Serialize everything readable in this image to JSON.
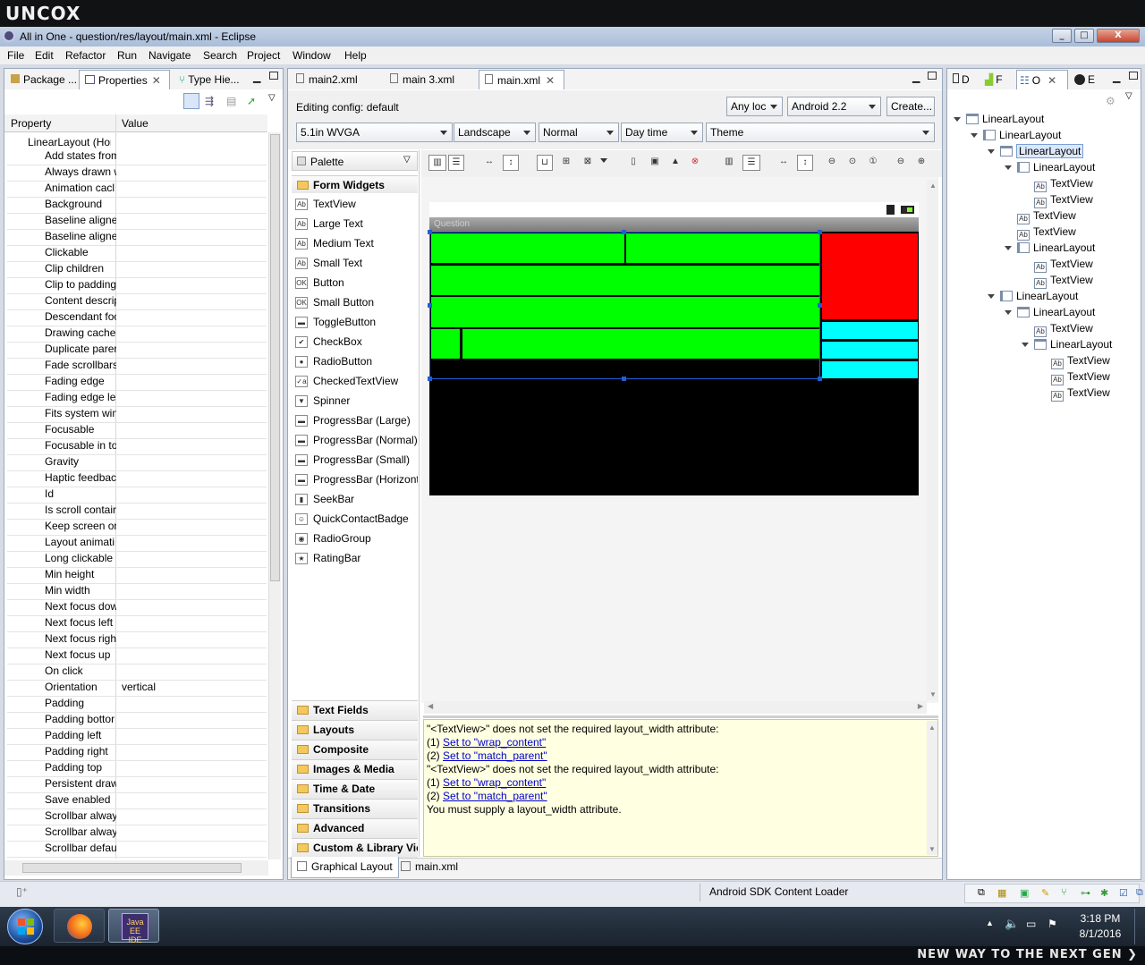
{
  "brand": "UNCOX",
  "window": {
    "title": "All in One - question/res/layout/main.xml - Eclipse",
    "min": "_",
    "max": "□",
    "close": "X"
  },
  "menu": [
    "File",
    "Edit",
    "Refactor",
    "Run",
    "Navigate",
    "Search",
    "Project",
    "Window",
    "Help"
  ],
  "left_tabs": [
    "Package ...",
    "Properties",
    "Type Hie..."
  ],
  "properties": {
    "col_property": "Property",
    "col_value": "Value",
    "root": "LinearLayout (Hori",
    "rows": [
      {
        "name": "Add states from",
        "value": ""
      },
      {
        "name": "Always drawn w",
        "value": ""
      },
      {
        "name": "Animation cacl",
        "value": ""
      },
      {
        "name": "Background",
        "value": ""
      },
      {
        "name": "Baseline aligne",
        "value": ""
      },
      {
        "name": "Baseline aligne",
        "value": ""
      },
      {
        "name": "Clickable",
        "value": ""
      },
      {
        "name": "Clip children",
        "value": ""
      },
      {
        "name": "Clip to padding",
        "value": ""
      },
      {
        "name": "Content descrip",
        "value": ""
      },
      {
        "name": "Descendant foc",
        "value": ""
      },
      {
        "name": "Drawing cache",
        "value": ""
      },
      {
        "name": "Duplicate parer",
        "value": ""
      },
      {
        "name": "Fade scrollbars",
        "value": ""
      },
      {
        "name": "Fading edge",
        "value": ""
      },
      {
        "name": "Fading edge ler",
        "value": ""
      },
      {
        "name": "Fits system win",
        "value": ""
      },
      {
        "name": "Focusable",
        "value": ""
      },
      {
        "name": "Focusable in to",
        "value": ""
      },
      {
        "name": "Gravity",
        "value": ""
      },
      {
        "name": "Haptic feedbac",
        "value": ""
      },
      {
        "name": "Id",
        "value": ""
      },
      {
        "name": "Is scroll contair",
        "value": ""
      },
      {
        "name": "Keep screen on",
        "value": ""
      },
      {
        "name": "Layout animati",
        "value": ""
      },
      {
        "name": "Long clickable",
        "value": ""
      },
      {
        "name": "Min height",
        "value": ""
      },
      {
        "name": "Min width",
        "value": ""
      },
      {
        "name": "Next focus dow",
        "value": ""
      },
      {
        "name": "Next focus left",
        "value": ""
      },
      {
        "name": "Next focus righ",
        "value": ""
      },
      {
        "name": "Next focus up",
        "value": ""
      },
      {
        "name": "On click",
        "value": ""
      },
      {
        "name": "Orientation",
        "value": "vertical"
      },
      {
        "name": "Padding",
        "value": ""
      },
      {
        "name": "Padding bottor",
        "value": ""
      },
      {
        "name": "Padding left",
        "value": ""
      },
      {
        "name": "Padding right",
        "value": ""
      },
      {
        "name": "Padding top",
        "value": ""
      },
      {
        "name": "Persistent draw",
        "value": ""
      },
      {
        "name": "Save enabled",
        "value": ""
      },
      {
        "name": "Scrollbar alway",
        "value": ""
      },
      {
        "name": "Scrollbar alway",
        "value": ""
      },
      {
        "name": "Scrollbar defau",
        "value": ""
      }
    ]
  },
  "editor_tabs": [
    "main2.xml",
    "main 3.xml",
    "main.xml"
  ],
  "config": {
    "label": "Editing config:",
    "value": "default",
    "locale": "Any loc",
    "target": "Android 2.2",
    "create": "Create...",
    "device": "5.1in WVGA",
    "orientation": "Landscape",
    "dock": "Normal",
    "night": "Day time",
    "theme": "Theme"
  },
  "palette": {
    "title": "Palette",
    "open_section": "Form Widgets",
    "items": [
      {
        "label": "TextView",
        "icon": "Ab"
      },
      {
        "label": "Large Text",
        "icon": "Ab"
      },
      {
        "label": "Medium Text",
        "icon": "Ab"
      },
      {
        "label": "Small Text",
        "icon": "Ab"
      },
      {
        "label": "Button",
        "icon": "OK"
      },
      {
        "label": "Small Button",
        "icon": "OK"
      },
      {
        "label": "ToggleButton",
        "icon": "▬"
      },
      {
        "label": "CheckBox",
        "icon": "✔"
      },
      {
        "label": "RadioButton",
        "icon": "●"
      },
      {
        "label": "CheckedTextView",
        "icon": "✓a"
      },
      {
        "label": "Spinner",
        "icon": "▼"
      },
      {
        "label": "ProgressBar (Large)",
        "icon": "▬"
      },
      {
        "label": "ProgressBar (Normal)",
        "icon": "▬"
      },
      {
        "label": "ProgressBar (Small)",
        "icon": "▬"
      },
      {
        "label": "ProgressBar (Horizonta",
        "icon": "▬"
      },
      {
        "label": "SeekBar",
        "icon": "▮"
      },
      {
        "label": "QuickContactBadge",
        "icon": "☺"
      },
      {
        "label": "RadioGroup",
        "icon": "◉"
      },
      {
        "label": "RatingBar",
        "icon": "★"
      }
    ],
    "sections": [
      "Text Fields",
      "Layouts",
      "Composite",
      "Images & Media",
      "Time & Date",
      "Transitions",
      "Advanced",
      "Custom & Library Vie"
    ]
  },
  "device_screen": {
    "app_title": "Question"
  },
  "errors": {
    "msg1": "\"<TextView>\" does not set the required layout_width attribute:",
    "fix1a_num": "(1)",
    "fix1a": "Set to \"wrap_content\"",
    "fix1b_num": "(2)",
    "fix1b": "Set to \"match_parent\"",
    "msg2": "\"<TextView>\" does not set the required layout_width attribute:",
    "fix2a_num": "(1)",
    "fix2a": "Set to \"wrap_content\"",
    "fix2b_num": "(2)",
    "fix2b": "Set to \"match_parent\"",
    "msg3": "You must supply a layout_width attribute."
  },
  "bottom_tabs": [
    "Graphical Layout",
    "main.xml"
  ],
  "right_tabs": [
    "D",
    "F",
    "O",
    "E"
  ],
  "outline": [
    {
      "label": "LinearLayout",
      "depth": 0,
      "icon": "H",
      "expand": true
    },
    {
      "label": "LinearLayout",
      "depth": 1,
      "icon": "V",
      "expand": true
    },
    {
      "label": "LinearLayout",
      "depth": 2,
      "icon": "H",
      "expand": true,
      "selected": true
    },
    {
      "label": "LinearLayout",
      "depth": 3,
      "icon": "V",
      "expand": true
    },
    {
      "label": "TextView",
      "depth": 4,
      "icon": "Ab",
      "expand": false
    },
    {
      "label": "TextView",
      "depth": 4,
      "icon": "Ab",
      "expand": false
    },
    {
      "label": "TextView",
      "depth": 3,
      "icon": "Ab",
      "expand": false
    },
    {
      "label": "TextView",
      "depth": 3,
      "icon": "Ab",
      "expand": false
    },
    {
      "label": "LinearLayout",
      "depth": 3,
      "icon": "V",
      "expand": true
    },
    {
      "label": "TextView",
      "depth": 4,
      "icon": "Ab",
      "expand": false
    },
    {
      "label": "TextView",
      "depth": 4,
      "icon": "Ab",
      "expand": false
    },
    {
      "label": "LinearLayout",
      "depth": 2,
      "icon": "V",
      "expand": true
    },
    {
      "label": "LinearLayout",
      "depth": 3,
      "icon": "H",
      "expand": true
    },
    {
      "label": "TextView",
      "depth": 4,
      "icon": "Ab",
      "expand": false
    },
    {
      "label": "LinearLayout",
      "depth": 4,
      "icon": "H",
      "expand": true
    },
    {
      "label": "TextView",
      "depth": 5,
      "icon": "Ab",
      "expand": false
    },
    {
      "label": "TextView",
      "depth": 5,
      "icon": "Ab",
      "expand": false
    },
    {
      "label": "TextView",
      "depth": 5,
      "icon": "Ab",
      "expand": false
    }
  ],
  "status": {
    "loader": "Android SDK Content Loader"
  },
  "taskbar": {
    "time": "3:18 PM",
    "date": "8/1/2016",
    "eclipse_label": "Java EE IDE"
  },
  "footer_text": "NEW WAY TO THE NEXT GEN ❯",
  "colors": {
    "green": "#00ff00",
    "red": "#ff0000",
    "cyan": "#00ffff",
    "black": "#000000",
    "accent": "#1e5fd6"
  }
}
